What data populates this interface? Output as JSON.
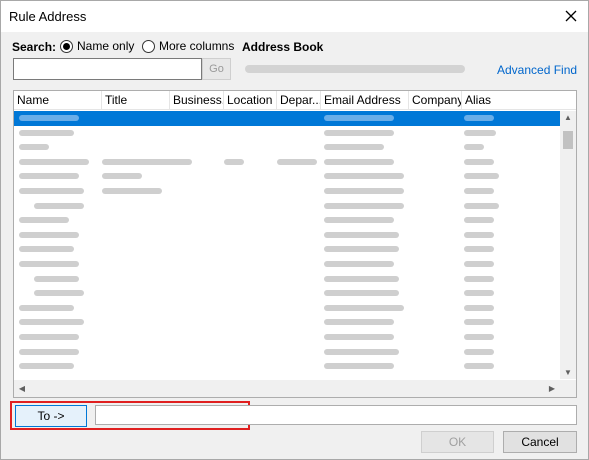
{
  "window": {
    "title": "Rule Address"
  },
  "search": {
    "label": "Search:",
    "options": [
      "Name only",
      "More columns"
    ],
    "selected": "Name only",
    "input_value": "",
    "go_label": "Go"
  },
  "address_book": {
    "label": "Address Book",
    "advanced_find": "Advanced Find"
  },
  "columns": [
    "Name",
    "Title",
    "Business...",
    "Location",
    "Depar...",
    "Email Address",
    "Company",
    "Alias"
  ],
  "to": {
    "button_label": "To ->",
    "value": ""
  },
  "buttons": {
    "ok": "OK",
    "cancel": "Cancel"
  },
  "colors": {
    "selection": "#0078d7",
    "link": "#0066cc",
    "highlight_box": "#e02020"
  }
}
